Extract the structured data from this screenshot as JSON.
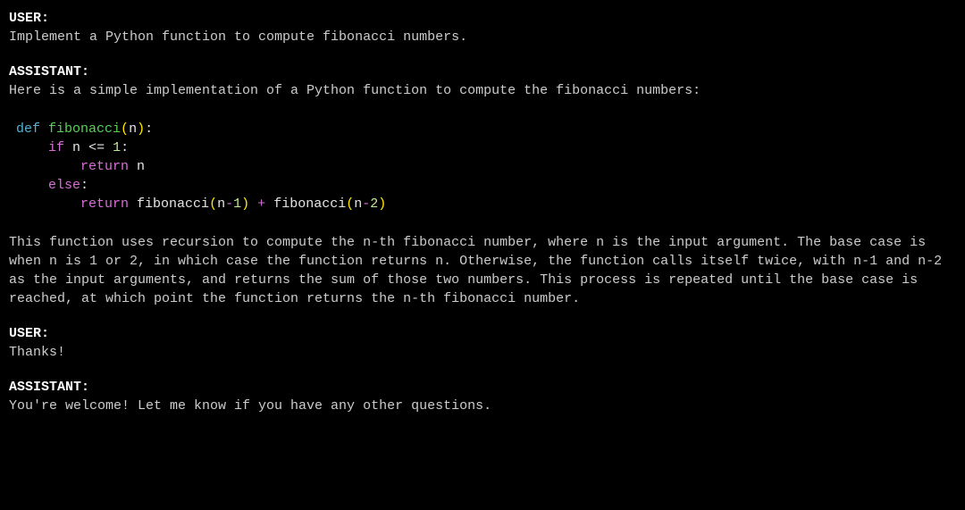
{
  "turns": [
    {
      "role_label": "USER:",
      "text": "Implement a Python function to compute fibonacci numbers."
    },
    {
      "role_label": "ASSISTANT:",
      "text_before": "Here is a simple implementation of a Python function to compute the fibonacci numbers:",
      "code": {
        "line1": {
          "def": "def",
          "sp1": " ",
          "func": "fibonacci",
          "lp": "(",
          "param": "n",
          "rp": ")",
          "colon": ":"
        },
        "line2": {
          "indent": "    ",
          "if": "if",
          "sp1": " ",
          "var": "n",
          "sp2": " ",
          "op": "<=",
          "sp3": " ",
          "num": "1",
          "colon": ":"
        },
        "line3": {
          "indent": "        ",
          "ret": "return",
          "sp1": " ",
          "var": "n"
        },
        "line4": {
          "indent": "    ",
          "else": "else",
          "colon": ":"
        },
        "line5": {
          "indent": "        ",
          "ret": "return",
          "sp1": " ",
          "func1": "fibonacci",
          "lp1": "(",
          "var1": "n",
          "op1": "-",
          "num1": "1",
          "rp1": ")",
          "sp2": " ",
          "plus": "+",
          "sp3": " ",
          "func2": "fibonacci",
          "lp2": "(",
          "var2": "n",
          "op2": "-",
          "num2": "2",
          "rp2": ")"
        }
      },
      "text_after": "This function uses recursion to compute the n-th fibonacci number, where n is the input argument. The base case is when n is 1 or 2, in which case the function returns n. Otherwise, the function calls itself twice, with n-1 and n-2 as the input arguments, and returns the sum of those two numbers. This process is repeated until the base case is reached, at which point the function returns the n-th fibonacci number."
    },
    {
      "role_label": "USER:",
      "text": "Thanks!"
    },
    {
      "role_label": "ASSISTANT:",
      "text": "You're welcome! Let me know if you have any other questions."
    }
  ]
}
